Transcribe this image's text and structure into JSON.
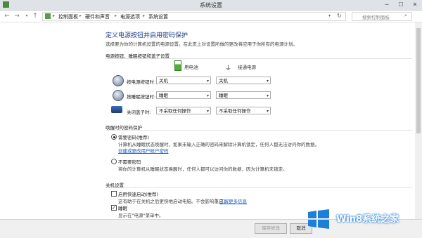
{
  "window": {
    "title": "系统设置"
  },
  "address": {
    "crumbs": [
      "控制面板",
      "硬件和声音",
      "电源选项",
      "系统设置"
    ],
    "search_placeholder": "搜索控制面板"
  },
  "page": {
    "heading": "定义电源按钮并启用密码保护",
    "description": "选择要为你的计算机设置的电源设置。在此页上对设置所做的更改将应用于你所有的电源计划。"
  },
  "power_section": {
    "title": "电源按钮、睡眠按钮和盖子设置",
    "col_battery": "用电池",
    "col_plugged": "接通电源",
    "rows": [
      {
        "label": "按电源按钮时:",
        "battery": "关机",
        "plugged": "关机"
      },
      {
        "label": "按睡眠按钮时:",
        "battery": "睡眠",
        "plugged": "睡眠"
      },
      {
        "label": "关闭盖子时:",
        "battery": "不采取任何操作",
        "plugged": "不采取任何操作"
      }
    ]
  },
  "wake_section": {
    "title": "唤醒时的密码保护",
    "opt1_label": "需要密码(推荐)",
    "opt1_desc1": "计算机从睡眠状态唤醒时，如果未输入正确的密码来解除计算机锁定，任何人都无法访问你的数据。",
    "opt1_link": "创建或更改用户帐户密码",
    "opt2_label": "不需要密码",
    "opt2_desc": "将你的计算机从睡眠状态唤醒时，任何人都可以访问你的数据，因为计算机未锁定。"
  },
  "shutdown_section": {
    "title": "关机设置",
    "fast_label": "启用快速启动(推荐)",
    "fast_desc": "这有助于在关机之后更快地启动电脑。不会影响重启。",
    "fast_link": "了解更多信息",
    "sleep_label": "睡眠",
    "sleep_desc": "显示在\"电源\"菜单中。"
  },
  "buttons": {
    "save": "保存修改",
    "cancel": "取消"
  },
  "watermark": {
    "text": "Win8系统之家"
  },
  "colors": {
    "heading": "#1e3f8a",
    "link": "#1a5fc7",
    "win_logo": "#1e7fd8"
  }
}
